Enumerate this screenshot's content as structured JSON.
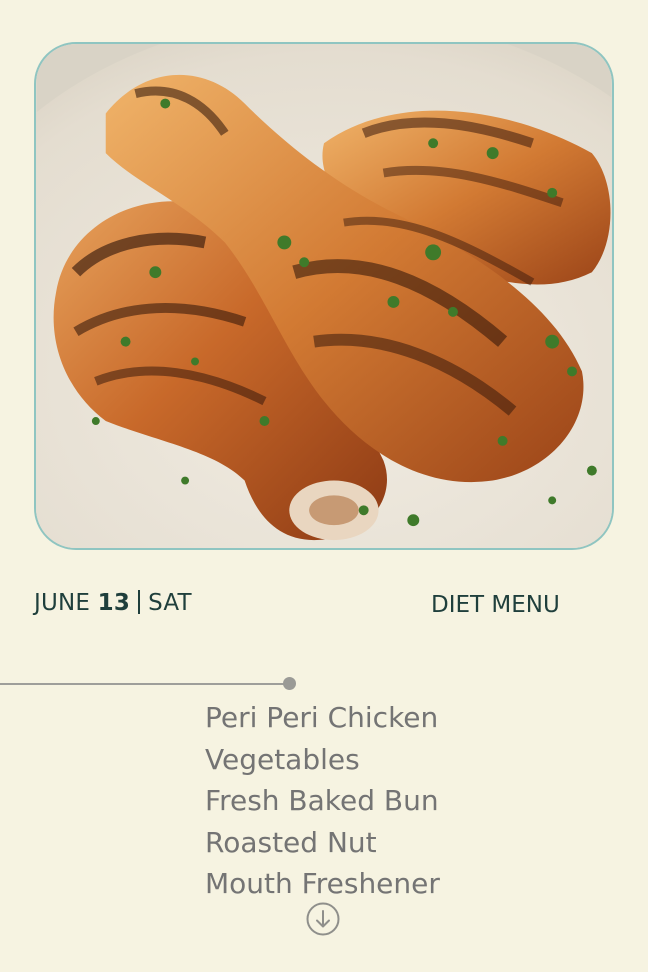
{
  "date": {
    "month": "JUNE",
    "day": "13",
    "weekday": "SAT"
  },
  "menu_title": "DIET MENU",
  "menu_items": [
    "Peri Peri Chicken",
    "Vegetables",
    "Fresh Baked Bun",
    "Roasted Nut",
    "Mouth Freshener"
  ],
  "icons": {
    "scroll": "arrow-down-circle-icon"
  },
  "colors": {
    "background": "#f6f3e1",
    "text_dark": "#1f3f3c",
    "text_muted": "#747474",
    "frame_border": "#8fc5c1"
  }
}
